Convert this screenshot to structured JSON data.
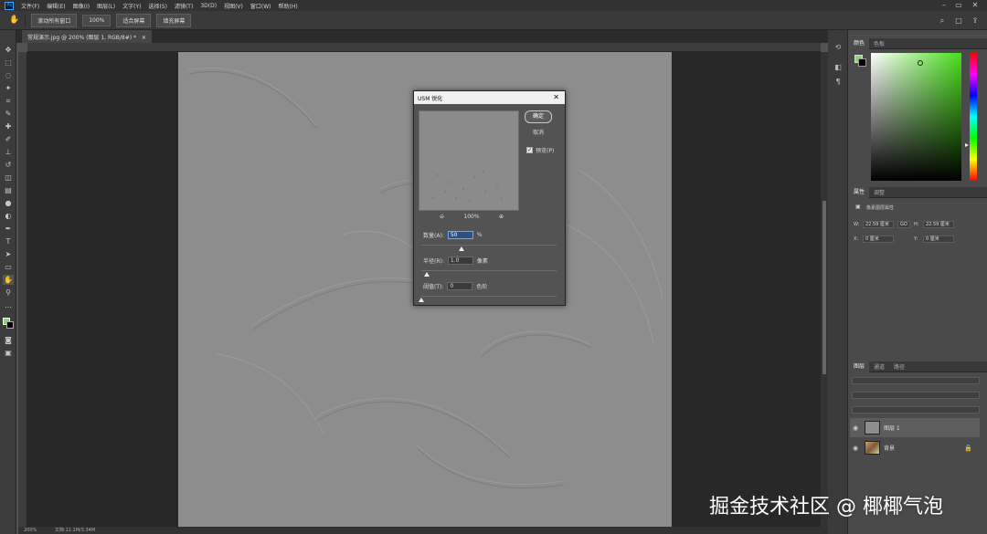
{
  "menubar": {
    "logo": "Ps",
    "items": [
      "文件(F)",
      "编辑(E)",
      "图像(I)",
      "图层(L)",
      "文字(Y)",
      "选择(S)",
      "滤镜(T)",
      "3D(D)",
      "视图(V)",
      "窗口(W)",
      "帮助(H)"
    ]
  },
  "options": {
    "scroll_all": "滚动所有窗口",
    "zoom": "100%",
    "fit_screen": "适合屏幕",
    "fill_screen": "填充屏幕"
  },
  "document": {
    "tab_title": "常规演示.jpg @ 200% (图层 1, RGB/8#) *",
    "status_zoom": "200%",
    "status_doc": "文档:11.1M/3.34M"
  },
  "dialog": {
    "title": "USM 锐化",
    "ok": "确定",
    "cancel": "取消",
    "preview_label": "预览(P)",
    "preview_zoom": "100%",
    "amount_label": "数量(A):",
    "amount_value": "50",
    "amount_unit": "%",
    "amount_slider": 0.3,
    "radius_label": "半径(R):",
    "radius_value": "1.0",
    "radius_unit": "像素",
    "radius_slider": 0.04,
    "threshold_label": "阈值(T):",
    "threshold_value": "0",
    "threshold_unit": "色阶",
    "threshold_slider": 0.0
  },
  "panels": {
    "color_tabs": [
      "颜色",
      "色板"
    ],
    "foreground_color": "#8fd474",
    "background_color": "#000000",
    "props_tabs": [
      "属性",
      "调整"
    ],
    "props_layer_label": "像素图层属性",
    "props": {
      "w_label": "W:",
      "w": "22.59 厘米",
      "h_label": "H:",
      "h": "22.59 厘米",
      "go": "GO",
      "x_label": "X:",
      "x": "0 厘米",
      "y_label": "Y:",
      "y": "0 厘米"
    },
    "layers_tabs": [
      "图层",
      "通道",
      "路径"
    ],
    "layers": [
      {
        "name": "图层 1",
        "selected": true
      },
      {
        "name": "背景",
        "selected": false,
        "locked": true
      }
    ]
  },
  "watermark": "掘金技术社区 @ 椰椰气泡"
}
